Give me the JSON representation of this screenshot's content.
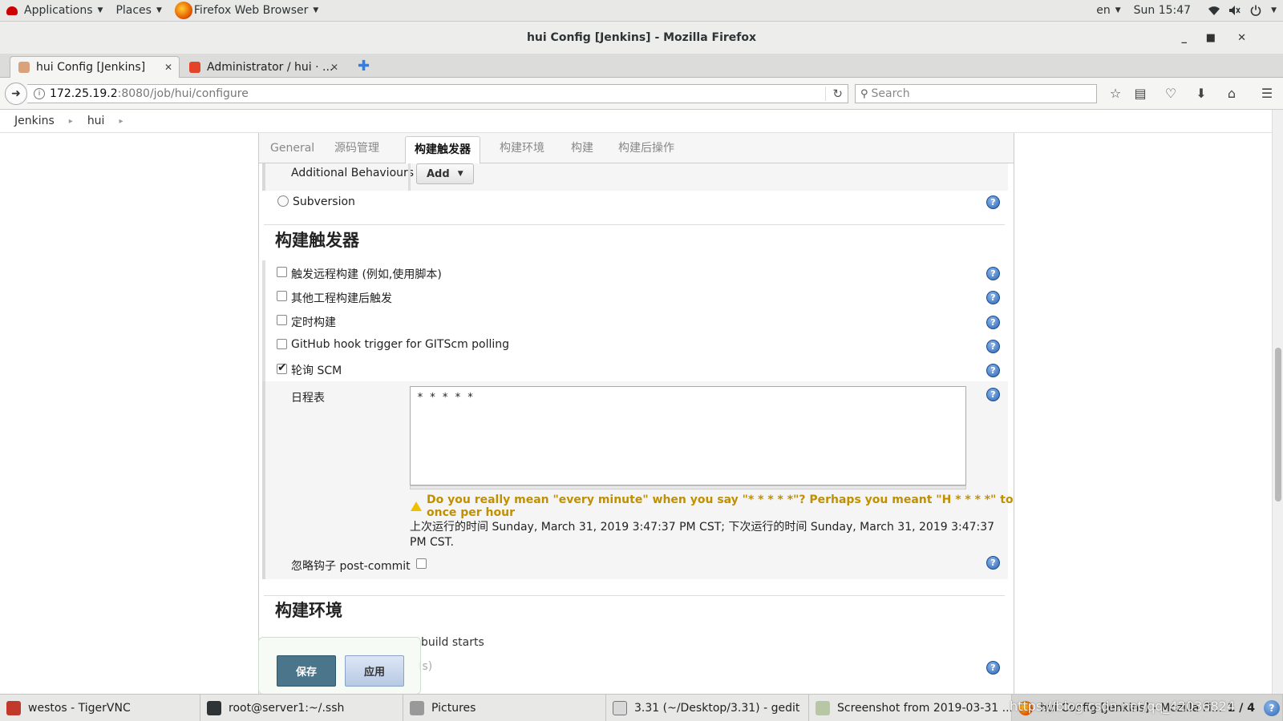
{
  "topbar": {
    "applications": "Applications",
    "places": "Places",
    "browser": "Firefox Web Browser",
    "lang": "en",
    "clock": "Sun 15:47"
  },
  "window": {
    "title": "hui Config [Jenkins] - Mozilla Firefox"
  },
  "tabs": [
    {
      "label": "hui Config [Jenkins]"
    },
    {
      "label": "Administrator / hui · ..."
    }
  ],
  "nav": {
    "url_host": "172.25.19.2",
    "url_path": ":8080/job/hui/configure",
    "search_placeholder": "Search"
  },
  "breadcrumb": [
    "Jenkins",
    "hui"
  ],
  "config_tabs": [
    "General",
    "源码管理",
    "构建触发器",
    "构建环境",
    "构建",
    "构建后操作"
  ],
  "scm": {
    "additional_behaviours": "Additional Behaviours",
    "add_label": "Add",
    "subversion": "Subversion"
  },
  "triggers": {
    "title": "构建触发器",
    "options": [
      {
        "label": "触发远程构建 (例如,使用脚本)",
        "checked": false
      },
      {
        "label": "其他工程构建后触发",
        "checked": false
      },
      {
        "label": "定时构建",
        "checked": false
      },
      {
        "label": "GitHub hook trigger for GITScm polling",
        "checked": false
      },
      {
        "label": "轮询 SCM",
        "checked": true
      }
    ],
    "schedule_label": "日程表",
    "schedule_value": "* * * * *",
    "warning_line1": "Do you really mean \"every minute\" when you say \"* * * * *\"? Perhaps you meant \"H * * * *\" to poll",
    "warning_line2": "once per hour",
    "run_info_line1": "上次运行的时间 Sunday, March 31, 2019 3:47:37 PM CST; 下次运行的时间 Sunday, March 31, 2019 3:47:37",
    "run_info_line2": "PM CST.",
    "ignore_hook": "忽略钩子 post-commit"
  },
  "build_env": {
    "title": "构建环境",
    "partial_1": "build starts",
    "partial_2": "(s)"
  },
  "actions": {
    "save": "保存",
    "apply": "应用"
  },
  "taskbar": [
    {
      "label": "westos - TigerVNC"
    },
    {
      "label": "root@server1:~/.ssh"
    },
    {
      "label": "Pictures"
    },
    {
      "label": "3.31 (~/Desktop/3.31) - gedit"
    },
    {
      "label": "Screenshot from 2019-03-31 ..."
    },
    {
      "label": "hui Config [Jenkins] - Mozilla Fi..."
    }
  ],
  "pager": "1 / 4",
  "watermark": "https://blog.csdn.net/qq_42036824"
}
